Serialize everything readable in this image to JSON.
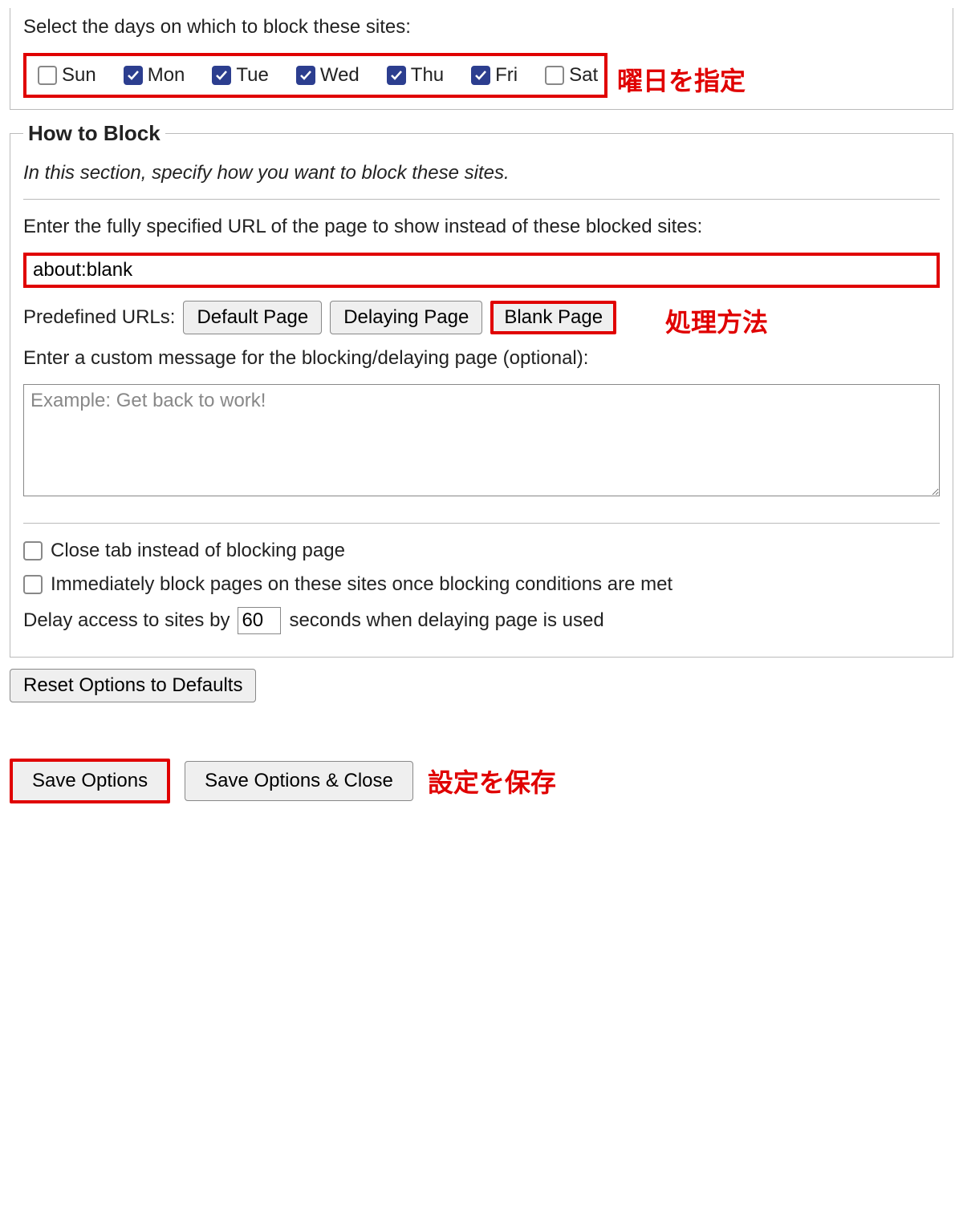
{
  "days": {
    "prompt": "Select the days on which to block these sites:",
    "items": [
      {
        "label": "Sun",
        "checked": false
      },
      {
        "label": "Mon",
        "checked": true
      },
      {
        "label": "Tue",
        "checked": true
      },
      {
        "label": "Wed",
        "checked": true
      },
      {
        "label": "Thu",
        "checked": true
      },
      {
        "label": "Fri",
        "checked": true
      },
      {
        "label": "Sat",
        "checked": false
      }
    ],
    "annotation": "曜日を指定"
  },
  "howto": {
    "legend": "How to Block",
    "intro": "In this section, specify how you want to block these sites.",
    "url_prompt": "Enter the fully specified URL of the page to show instead of these blocked sites:",
    "url_value": "about:blank",
    "predef_label": "Predefined URLs:",
    "predef_buttons": {
      "default": "Default Page",
      "delay": "Delaying Page",
      "blank": "Blank Page"
    },
    "method_annotation": "処理方法",
    "msg_prompt": "Enter a custom message for the blocking/delaying page (optional):",
    "msg_placeholder": "Example: Get back to work!",
    "msg_value": "",
    "close_tab_label": "Close tab instead of blocking page",
    "close_tab_checked": false,
    "immediate_label": "Immediately block pages on these sites once blocking conditions are met",
    "immediate_checked": false,
    "delay_prefix": "Delay access to sites by",
    "delay_value": "60",
    "delay_suffix": "seconds when delaying page is used"
  },
  "reset_label": "Reset Options to Defaults",
  "save": {
    "save": "Save Options",
    "save_close": "Save Options & Close",
    "annotation": "設定を保存"
  }
}
